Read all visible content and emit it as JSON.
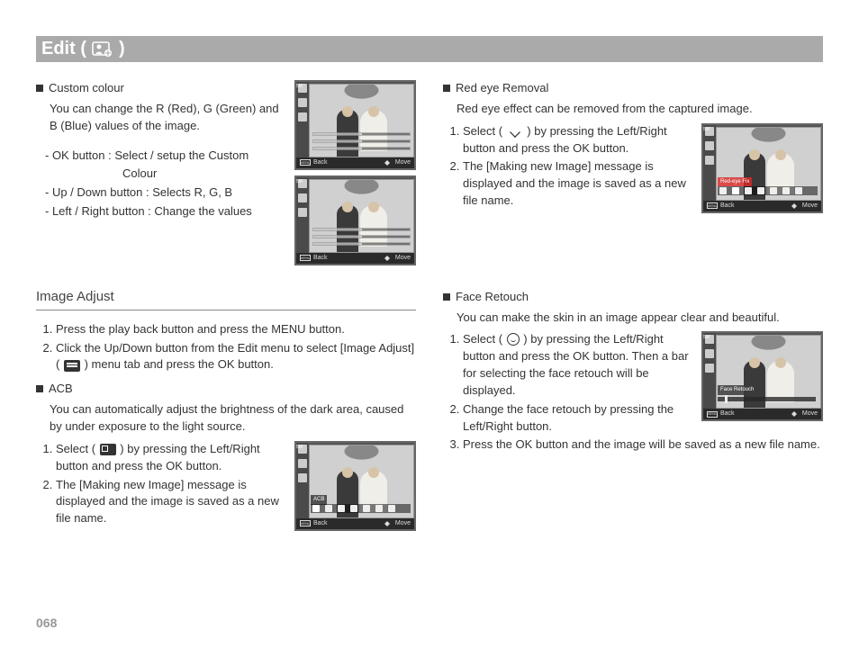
{
  "header": {
    "title_prefix": "Edit (",
    "title_suffix": " )"
  },
  "left": {
    "custom_colour": {
      "heading": "Custom colour",
      "desc": "You can change the R (Red), G (Green) and B (Blue) values of the image.",
      "controls": {
        "ok": "- OK button : Select / setup the Custom",
        "ok_line2": "Colour",
        "updown": "- Up / Down button  : Selects R, G, B",
        "lr": "- Left / Right button  : Change the values"
      }
    },
    "image_adjust": {
      "heading": "Image Adjust",
      "steps": [
        "Press the play back button and press the MENU button.",
        "Click the Up/Down button from the Edit menu to select [Image Adjust] (      ) menu tab and press the OK button."
      ]
    },
    "acb": {
      "heading": "ACB",
      "desc": "You can automatically adjust the brightness of the dark area, caused by under exposure to the light source.",
      "steps": [
        "Select (      ) by pressing the Left/Right button and press the OK button.",
        "The [Making new Image] message is displayed and the image is saved as a new file name."
      ],
      "caption": "ACB"
    }
  },
  "right": {
    "redeye": {
      "heading": "Red eye Removal",
      "desc": "Red eye effect can be removed from the captured image.",
      "steps": [
        "Select (      ) by pressing the Left/Right button and press the OK button.",
        "The [Making new Image] message is displayed and the image is saved as a new file name."
      ],
      "caption": "Red-eye Fix"
    },
    "face": {
      "heading": "Face Retouch",
      "desc": "You can make the skin in an image appear clear and beautiful.",
      "steps": [
        "Select (      ) by pressing the Left/Right button and press the OK button. Then a bar for selecting the face retouch will be displayed.",
        "Change the face retouch by pressing the Left/Right button.",
        "Press the OK button and the image will be saved as a new file name."
      ],
      "caption": "Face Retouch"
    }
  },
  "lcd": {
    "menu": "MENU",
    "back": "Back",
    "move": "Move",
    "side_mode": "5M"
  },
  "pagenum": "068"
}
